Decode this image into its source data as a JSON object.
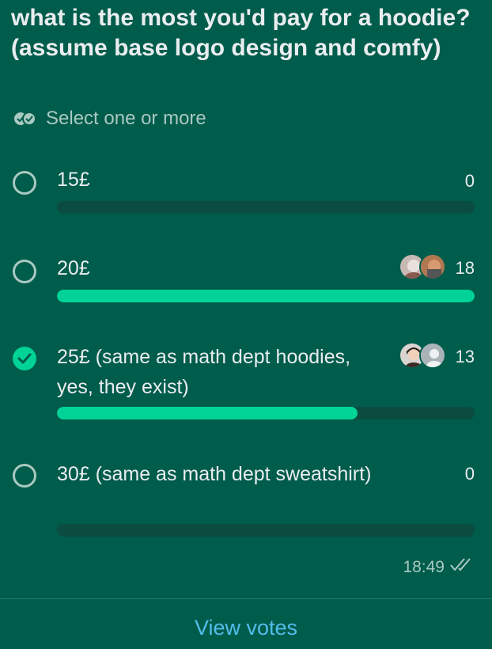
{
  "poll": {
    "question": "what is the most you'd pay for a hoodie? (assume base logo design and comfy)",
    "hint": "Select one or more",
    "hint_icon": "double-check-circle-icon",
    "accent_color": "#00d395",
    "options": [
      {
        "label": "15£",
        "count": "0",
        "votes": 0,
        "selected": false,
        "voters": []
      },
      {
        "label": "20£",
        "count": "18",
        "votes": 18,
        "selected": false,
        "voters": [
          "avatar",
          "avatar"
        ]
      },
      {
        "label": "25£ (same as math dept hoodies, yes, they exist)",
        "count": "13",
        "votes": 13,
        "selected": true,
        "voters": [
          "avatar",
          "default-avatar"
        ]
      },
      {
        "label": "30£ (same as math dept sweatshirt)",
        "count": "0",
        "votes": 0,
        "selected": false,
        "voters": []
      }
    ],
    "bar_fill_fractions": [
      0,
      1.0,
      0.72,
      0
    ]
  },
  "message": {
    "time": "18:49",
    "status_icon": "double-check-icon"
  },
  "footer": {
    "view_votes_label": "View votes"
  }
}
